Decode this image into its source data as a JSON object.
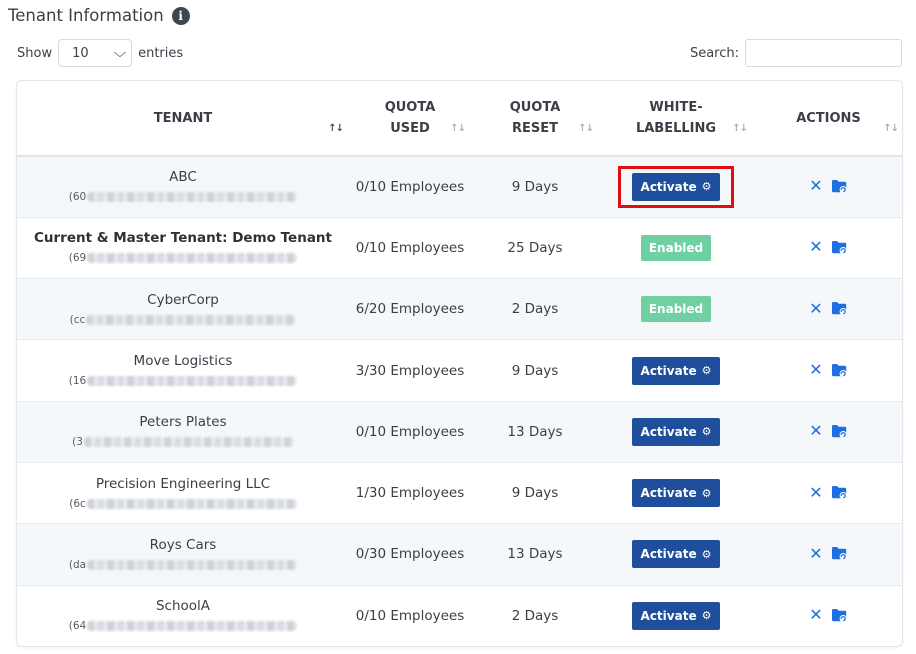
{
  "header": {
    "title": "Tenant Information",
    "info_icon": "info-circle-icon"
  },
  "controls": {
    "show_label": "Show",
    "entries_value": "10",
    "entries_label": "entries",
    "search_label": "Search:",
    "search_value": ""
  },
  "table": {
    "columns": [
      {
        "label_lines": [
          "TENANT"
        ],
        "sort": "both-active"
      },
      {
        "label_lines": [
          "QUOTA",
          "USED"
        ],
        "sort": "both"
      },
      {
        "label_lines": [
          "QUOTA",
          "RESET"
        ],
        "sort": "both"
      },
      {
        "label_lines": [
          "WHITE-",
          "LABELLING"
        ],
        "sort": "both"
      },
      {
        "label_lines": [
          "ACTIONS"
        ],
        "sort": "both"
      }
    ],
    "rows": [
      {
        "name": "ABC",
        "bold": false,
        "id_prefix": "(60",
        "quota_used": "0/10 Employees",
        "quota_reset": "9 Days",
        "white_labelling": "Activate",
        "type": "button",
        "highlighted": true
      },
      {
        "name": "Current & Master Tenant: Demo Tenant",
        "bold": true,
        "id_prefix": "(69",
        "quota_used": "0/10 Employees",
        "quota_reset": "25 Days",
        "white_labelling": "Enabled",
        "type": "badge",
        "highlighted": false
      },
      {
        "name": "CyberCorp",
        "bold": false,
        "id_prefix": "(cc",
        "quota_used": "6/20 Employees",
        "quota_reset": "2 Days",
        "white_labelling": "Enabled",
        "type": "badge",
        "highlighted": false
      },
      {
        "name": "Move Logistics",
        "bold": false,
        "id_prefix": "(16",
        "quota_used": "3/30 Employees",
        "quota_reset": "9 Days",
        "white_labelling": "Activate",
        "type": "button",
        "highlighted": false
      },
      {
        "name": "Peters Plates",
        "bold": false,
        "id_prefix": "(3",
        "quota_used": "0/10 Employees",
        "quota_reset": "13 Days",
        "white_labelling": "Activate",
        "type": "button",
        "highlighted": false
      },
      {
        "name": "Precision Engineering LLC",
        "bold": false,
        "id_prefix": "(6c",
        "quota_used": "1/30 Employees",
        "quota_reset": "9 Days",
        "white_labelling": "Activate",
        "type": "button",
        "highlighted": false
      },
      {
        "name": "Roys Cars",
        "bold": false,
        "id_prefix": "(da",
        "quota_used": "0/30 Employees",
        "quota_reset": "13 Days",
        "white_labelling": "Activate",
        "type": "button",
        "highlighted": false
      },
      {
        "name": "SchoolA",
        "bold": false,
        "id_prefix": "(64",
        "quota_used": "0/10 Employees",
        "quota_reset": "2 Days",
        "white_labelling": "Activate",
        "type": "button",
        "highlighted": false
      }
    ]
  },
  "colors": {
    "activate_button": "#1f4e9c",
    "enabled_badge": "#6fd0a1",
    "action_icon": "#1f6fe0",
    "highlight_box": "#e10d13"
  },
  "icons": {
    "delete": "close-x-icon",
    "folder": "folder-sync-icon",
    "gear": "gear-icon",
    "dropdown": "chevron-down-icon"
  }
}
